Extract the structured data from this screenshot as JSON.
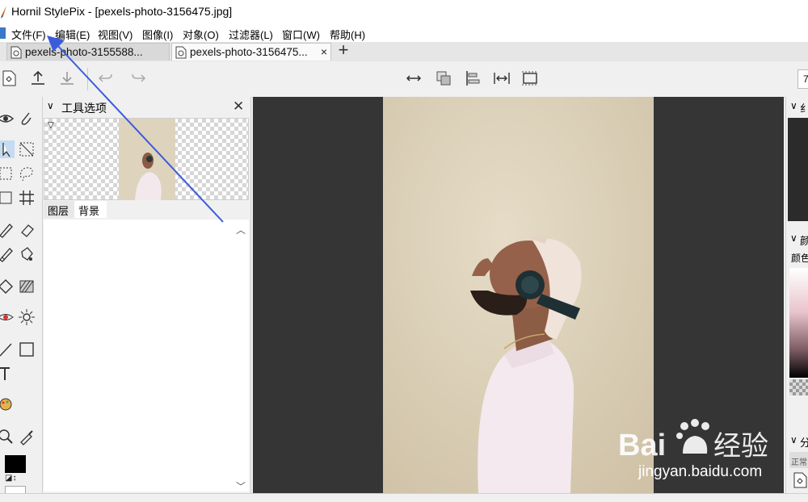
{
  "window": {
    "title": "Hornil StylePix - [pexels-photo-3156475.jpg]"
  },
  "menu": [
    {
      "label": "文件(F)"
    },
    {
      "label": "编辑(E)"
    },
    {
      "label": "视图(V)"
    },
    {
      "label": "图像(I)"
    },
    {
      "label": "对象(O)"
    },
    {
      "label": "过滤器(L)"
    },
    {
      "label": "窗口(W)"
    },
    {
      "label": "帮助(H)"
    }
  ],
  "tabs": [
    {
      "label": "pexels-photo-3155588...",
      "active": false
    },
    {
      "label": "pexels-photo-3156475...",
      "active": true,
      "close": "×"
    }
  ],
  "new_tab": "+",
  "zoom_value": "7",
  "tool_options": {
    "title": "工具选项",
    "close": "✕",
    "layer_tabs": [
      "图层",
      "背景"
    ]
  },
  "right_panels": [
    {
      "title": "纟"
    },
    {
      "title": "颜",
      "subtitle": "颜色"
    },
    {
      "title": "分",
      "mode": "正常"
    }
  ],
  "watermark": {
    "brand": "Bai",
    "brand_cn": "经验",
    "url": "jingyan.baidu.com"
  },
  "colors": {
    "foreground": "#000000",
    "background": "#ffffff",
    "canvas_bg": "#353535",
    "annotation": "#3b5bdb"
  }
}
